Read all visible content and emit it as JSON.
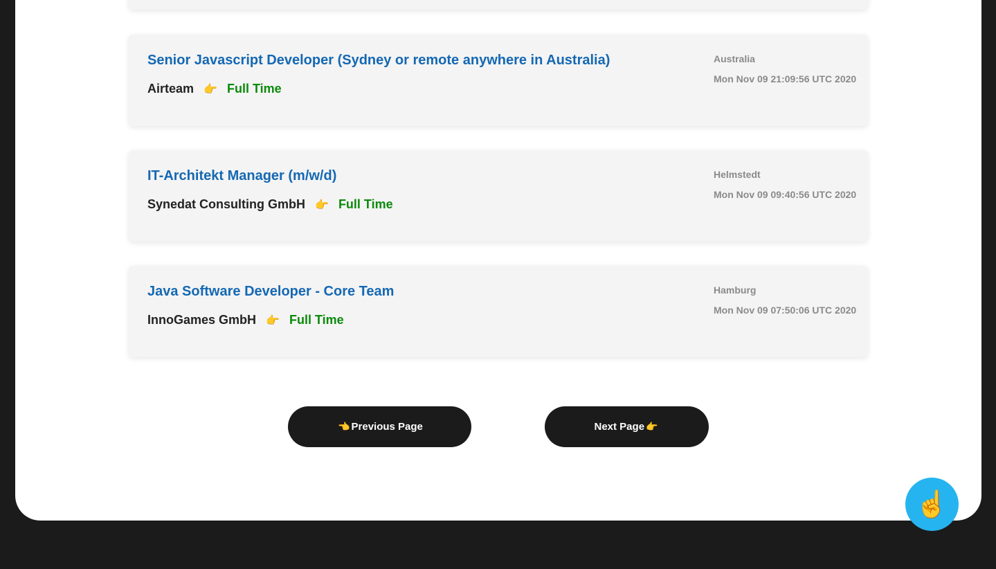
{
  "jobs": [
    {
      "title": "Senior Javascript Developer (Sydney or remote anywhere in Australia)",
      "company": "Airteam",
      "pointer_icon": "👉",
      "type": "Full Time",
      "location": "Australia",
      "posted": "Mon Nov 09 21:09:56 UTC 2020"
    },
    {
      "title": "IT-Architekt Manager (m/w/d)",
      "company": "Synedat Consulting GmbH",
      "pointer_icon": "👉",
      "type": "Full Time",
      "location": "Helmstedt",
      "posted": "Mon Nov 09 09:40:56 UTC 2020"
    },
    {
      "title": "Java Software Developer - Core Team",
      "company": "InnoGames GmbH",
      "pointer_icon": "👉",
      "type": "Full Time",
      "location": "Hamburg",
      "posted": "Mon Nov 09 07:50:06 UTC 2020"
    }
  ],
  "pagination": {
    "prev_icon": "👈",
    "prev_label": "Previous Page",
    "next_label": "Next Page",
    "next_icon": "👉"
  },
  "fab": {
    "icon": "☝️"
  },
  "colors": {
    "title": "#1468b3",
    "job_type": "#0b8a0b",
    "meta": "#8a8a8a",
    "background": "#1b1b1b",
    "card": "#f4f4f4",
    "fab": "#25b4f0"
  },
  "icons": {
    "pointer": "pointing-right-hand-icon",
    "prev": "pointing-left-hand-icon",
    "fab": "pointing-up-hand-icon"
  }
}
